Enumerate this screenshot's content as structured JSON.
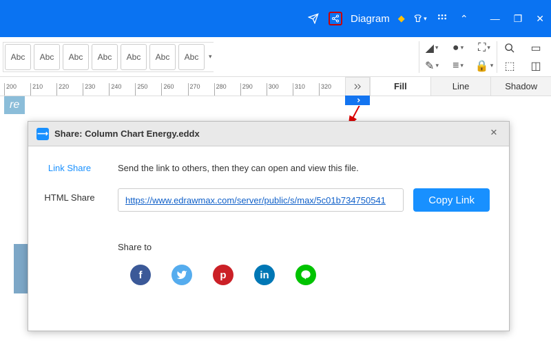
{
  "titlebar": {
    "diagram_label": "Diagram"
  },
  "toolbar": {
    "text_style_label": "Abc"
  },
  "ruler": {
    "ticks": [
      "200",
      "210",
      "220",
      "230",
      "240",
      "250",
      "260",
      "270",
      "280",
      "290",
      "300",
      "310",
      "320"
    ]
  },
  "right_tabs": {
    "fill": "Fill",
    "line": "Line",
    "shadow": "Shadow"
  },
  "canvas": {
    "tag": "re"
  },
  "dialog": {
    "title": "Share: Column Chart Energy.eddx",
    "side": {
      "link": "Link Share",
      "html": "HTML Share"
    },
    "description": "Send the link to others, then they can open and view this file.",
    "url": "https://www.edrawmax.com/server/public/s/max/5c01b734750541",
    "copy": "Copy Link",
    "share_to": "Share to",
    "social": {
      "fb": "f",
      "tw": "t",
      "pn": "p",
      "li": "in",
      "ln": "L"
    }
  }
}
